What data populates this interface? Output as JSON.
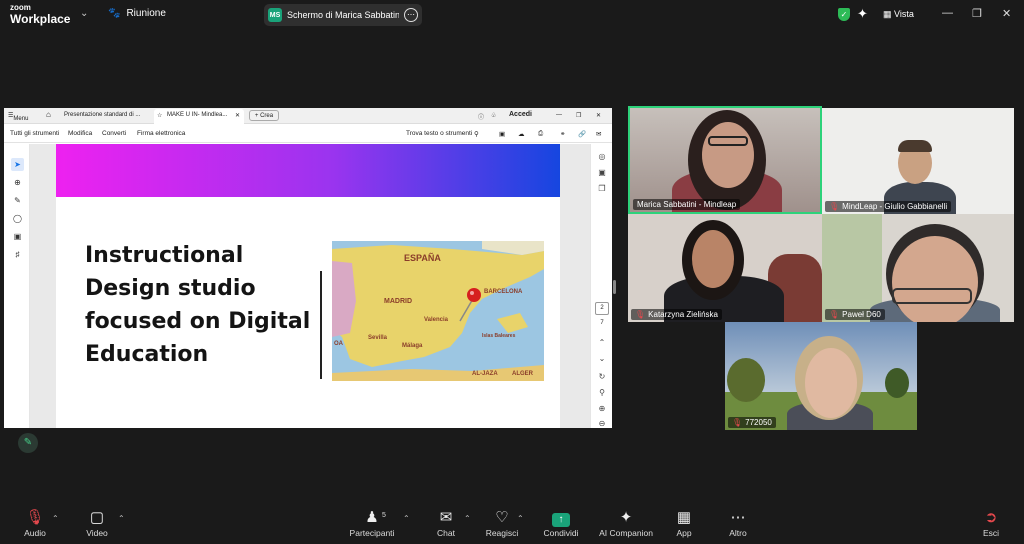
{
  "app": {
    "logo_small": "zoom",
    "logo_large": "Workplace"
  },
  "meeting": {
    "label": "Riunione"
  },
  "share": {
    "initials": "MS",
    "text": "Schermo di Marica Sabbatini - M"
  },
  "view": {
    "label": "Vista"
  },
  "acrobat": {
    "menu": "Menu",
    "tab1": "Presentazione standard di ...",
    "tab2": "MAKE U IN- Mindlea...",
    "new_button": "+ Crea",
    "signin": "Accedi",
    "tool_tabs": [
      "Tutti gli strumenti",
      "Modifica",
      "Converti",
      "Firma elettronica"
    ],
    "find": "Trova testo o strumenti",
    "page_current": "2",
    "page_total": "7"
  },
  "slide": {
    "title": "Instructional Design studio focused on Digital Education",
    "map_labels": [
      "ESPAÑA",
      "BARCELONA",
      "MADRID",
      "Valencia",
      "Sevilla",
      "Málaga",
      "ALGER",
      "Islas Baleares",
      "AL-JAZA",
      "OA"
    ]
  },
  "participants": [
    {
      "name": "Marica Sabbatini - Mindleap",
      "muted": false,
      "active": true
    },
    {
      "name": "MindLeap - Giulio Gabbianelli",
      "muted": true
    },
    {
      "name": "Katarzyna Zielińska",
      "muted": true
    },
    {
      "name": "Paweł D60",
      "muted": true
    },
    {
      "name": "772050",
      "muted": true
    }
  ],
  "toolbar": {
    "audio": "Audio",
    "video": "Video",
    "participants": "Partecipanti",
    "participants_count": "5",
    "chat": "Chat",
    "react": "Reagisci",
    "share": "Condividi",
    "ai": "AI Companion",
    "apps": "App",
    "more": "Altro",
    "leave": "Esci"
  },
  "colors": {
    "active_speaker": "#2dd27a",
    "share_green": "#1aa37a",
    "mute_red": "#e5484d"
  }
}
